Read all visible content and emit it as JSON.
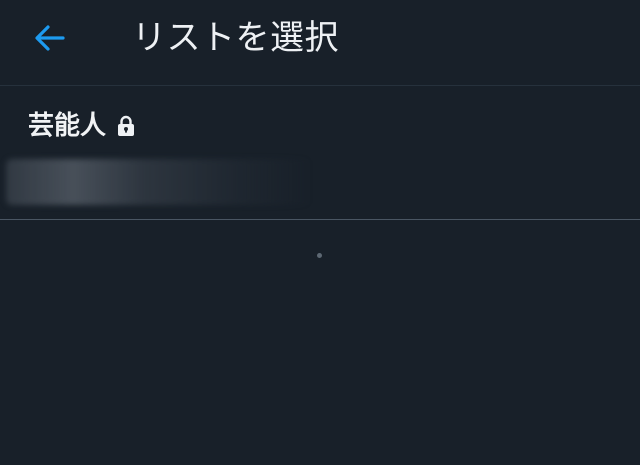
{
  "header": {
    "back_icon": "arrow-left-icon",
    "title": "リストを選択"
  },
  "lists": [
    {
      "name": "芸能人",
      "private": true,
      "lock_icon": "lock-icon"
    }
  ],
  "colors": {
    "background": "#182029",
    "accent": "#1d9bf0",
    "text": "#eef1f4",
    "divider": "#4a5663"
  }
}
